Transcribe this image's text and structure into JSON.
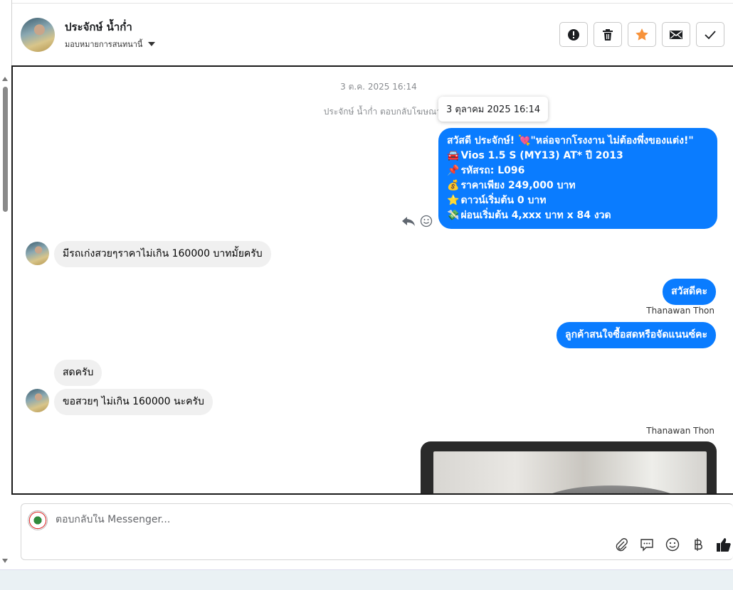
{
  "header": {
    "name": "ประจักษ์ น้ำก่ำ",
    "assign_label": "มอบหมายการสนทนานี้",
    "actions": [
      {
        "name": "mark-spam-button",
        "icon": "exclamation-icon"
      },
      {
        "name": "delete-button",
        "icon": "trash-icon"
      },
      {
        "name": "star-button",
        "icon": "star-icon",
        "color": "#f7923a"
      },
      {
        "name": "mark-unread-button",
        "icon": "envelope-icon"
      },
      {
        "name": "mark-done-button",
        "icon": "check-icon"
      }
    ]
  },
  "thread": {
    "date": "3 ต.ค. 2025 16:14",
    "ad_reply_note": "ประจักษ์ น้ำก่ำ ตอบกลับโฆษณา",
    "tooltip": "3 ตุลาคม 2025 16:14",
    "ad_message": {
      "lines": [
        {
          "emoji": "",
          "text": "สวัสดี ประจักษ์! 💘\"หล่อจากโรงงาน ไม่ต้องพึ่งของแต่ง!\""
        },
        {
          "emoji": "🚘",
          "text": "Vios 1.5 S (MY13) AT* ปี 2013"
        },
        {
          "emoji": "📌",
          "text": "รหัสรถ: L096"
        },
        {
          "emoji": "💰",
          "text": "ราคาเพียง 249,000 บาท"
        },
        {
          "emoji": "⭐",
          "text": "ดาวน์เริ่มต้น 0 บาท"
        },
        {
          "emoji": "💸",
          "text": "ผ่อนเริ่มต้น 4,xxx บาท x 84 งวด"
        }
      ]
    },
    "messages": {
      "in_1": "มีรถเก่งสวยๆราคาไม่เกิน 160000 บาทมั้ยครับ",
      "out_1": "สวัสดีคะ",
      "sender_1": "Thanawan Thon",
      "out_2": "ลูกค้าสนใจซื้อสดหรือจัดแนนซ์คะ",
      "in_2": "สดครับ",
      "in_3": "ขอสวยๆ ไม่เกิน 160000 นะครับ",
      "sender_2": "Thanawan Thon"
    }
  },
  "composer": {
    "placeholder": "ตอบกลับใน Messenger...",
    "tools": [
      "attach-icon",
      "saved-reply-icon",
      "emoji-icon",
      "baht-icon",
      "thumbs-up-icon"
    ]
  },
  "colors": {
    "outgoing_bubble": "#0a7cff",
    "incoming_bubble": "#f0f0f0",
    "star": "#f7923a"
  }
}
